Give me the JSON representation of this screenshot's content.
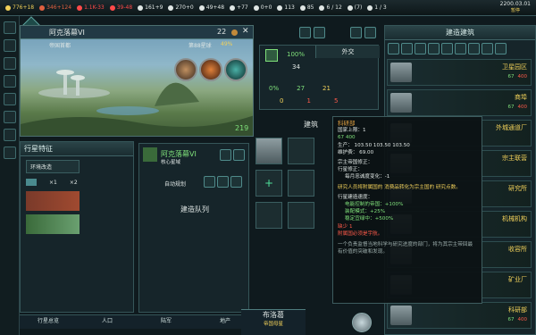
{
  "topbar": {
    "resources": [
      {
        "icon": "energy-icon",
        "value": "776+18",
        "color": "#f2d15a"
      },
      {
        "icon": "minerals-icon",
        "value": "346+124",
        "color": "#e06040"
      },
      {
        "icon": "food-icon",
        "value": "1.1K-33",
        "color": "#ff4a4a"
      },
      {
        "icon": "alloys-icon",
        "value": "39-48",
        "color": "#ff4a4a"
      },
      {
        "icon": "consumer-goods-icon",
        "value": "161+9",
        "color": "#dfe6e4"
      },
      {
        "icon": "influence-icon",
        "value": "270+0",
        "color": "#dfe6e4"
      },
      {
        "icon": "unity-icon",
        "value": "49+48",
        "color": "#dfe6e4"
      },
      {
        "icon": "research-icon",
        "value": "+77",
        "color": "#dfe6e4"
      },
      {
        "icon": "special-icon",
        "value": "0+0",
        "color": "#dfe6e4"
      },
      {
        "icon": "pop-icon",
        "value": "113",
        "color": "#dfe6e4"
      },
      {
        "icon": "stability-icon",
        "value": "85",
        "color": "#dfe6e4"
      },
      {
        "icon": "fleet-icon",
        "value": "6 / 12",
        "color": "#dfe6e4"
      },
      {
        "icon": "starbase-icon",
        "value": "(7)",
        "color": "#dfe6e4"
      },
      {
        "icon": "envoy-icon",
        "value": "1 / 3",
        "color": "#dfe6e4"
      }
    ],
    "date": "2200.03.01",
    "pause": "暂停"
  },
  "planet": {
    "name": "阿克落幕VI",
    "size": "22",
    "capital": "帝国首都",
    "star": "第88星球",
    "habitability": "49%",
    "stat": "219"
  },
  "stats": {
    "stability": "100%",
    "value34": "34",
    "diplomacy": "外交",
    "row1": [
      "0%",
      "27",
      "21"
    ],
    "row2": [
      "0",
      "1",
      "5"
    ]
  },
  "features": {
    "title": "行星特征",
    "mod": "环境改造",
    "count1": "×1",
    "count2": "×2"
  },
  "queue": {
    "planet": "阿克落幕VI",
    "core": "核心星域",
    "auto": "自动规划",
    "title": "建造队列"
  },
  "build_header": "建筑",
  "right": {
    "title": "建造建筑",
    "items": [
      {
        "name": "卫星园区",
        "cost1": "67",
        "cost2": "400"
      },
      {
        "name": "商埠",
        "cost1": "67",
        "cost2": "400"
      },
      {
        "name": "外城通道厂",
        "cost1": "",
        "cost2": ""
      },
      {
        "name": "宗主联营",
        "cost1": "",
        "cost2": ""
      },
      {
        "name": "研究所",
        "cost1": "",
        "cost2": ""
      },
      {
        "name": "机械机构",
        "cost1": "",
        "cost2": ""
      },
      {
        "name": "收容所",
        "cost1": "",
        "cost2": ""
      },
      {
        "name": "矿业厂",
        "cost1": "",
        "cost2": ""
      },
      {
        "name": "科研部",
        "cost1": "67",
        "cost2": "400"
      }
    ]
  },
  "tooltip": {
    "title": "科研部",
    "line1": "国家上限：1",
    "cost": "67  400",
    "prod": "生产：  103.50   103.50   103.50",
    "upkeep": "维护费：  69.00",
    "overlord": "宗主帝国修正：",
    "planet_mod": "行星修正：",
    "monthly": "每月忠诚度变化：-1",
    "research": "研究人员将附属国的  消费品转化为宗主国的  研究点数。",
    "speed": "行星建造速度：",
    "ctrl": "电能控制的帝国：+100%",
    "assembly": "装配模式：+25%",
    "stable": "稳定宜绿中：+500%",
    "lack": "缺少  1",
    "need": "附属国必须是宇航。",
    "desc": "一个负责监督当地科学与研究进度的部门，将为其宗主带回最有价值的突破和发现。"
  },
  "bottom_tabs": [
    "行星总览",
    "人口",
    "陆军",
    "地产"
  ],
  "bottom_planet": {
    "name": "布洛葛",
    "sub": "帝国母星"
  }
}
